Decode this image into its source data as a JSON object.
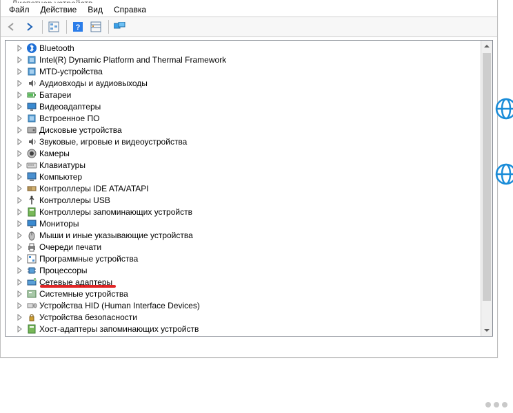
{
  "window": {
    "title": "Диспетчер устройств"
  },
  "menu": {
    "file": "Файл",
    "action": "Действие",
    "view": "Вид",
    "help": "Справка"
  },
  "toolbar": {
    "back": "arrow-left",
    "forward": "arrow-right",
    "show_tree": "show-tree",
    "help": "help",
    "show_hidden": "show-hidden",
    "monitors": "monitors"
  },
  "tree": {
    "items": [
      {
        "label": "Bluetooth",
        "icon": "bluetooth"
      },
      {
        "label": "Intel(R) Dynamic Platform and Thermal Framework",
        "icon": "chip"
      },
      {
        "label": "MTD-устройства",
        "icon": "chip"
      },
      {
        "label": "Аудиовходы и аудиовыходы",
        "icon": "audio"
      },
      {
        "label": "Батареи",
        "icon": "battery"
      },
      {
        "label": "Видеоадаптеры",
        "icon": "display"
      },
      {
        "label": "Встроенное ПО",
        "icon": "chip"
      },
      {
        "label": "Дисковые устройства",
        "icon": "disk"
      },
      {
        "label": "Звуковые, игровые и видеоустройства",
        "icon": "audio"
      },
      {
        "label": "Камеры",
        "icon": "camera"
      },
      {
        "label": "Клавиатуры",
        "icon": "keyboard"
      },
      {
        "label": "Компьютер",
        "icon": "computer"
      },
      {
        "label": "Контроллеры IDE ATA/ATAPI",
        "icon": "ide"
      },
      {
        "label": "Контроллеры USB",
        "icon": "usb"
      },
      {
        "label": "Контроллеры запоминающих устройств",
        "icon": "storage"
      },
      {
        "label": "Мониторы",
        "icon": "monitor"
      },
      {
        "label": "Мыши и иные указывающие устройства",
        "icon": "mouse"
      },
      {
        "label": "Очереди печати",
        "icon": "printer"
      },
      {
        "label": "Программные устройства",
        "icon": "software"
      },
      {
        "label": "Процессоры",
        "icon": "cpu"
      },
      {
        "label": "Сетевые адаптеры",
        "icon": "network",
        "underline": true
      },
      {
        "label": "Системные устройства",
        "icon": "system"
      },
      {
        "label": "Устройства HID (Human Interface Devices)",
        "icon": "hid"
      },
      {
        "label": "Устройства безопасности",
        "icon": "security"
      },
      {
        "label": "Хост-адаптеры запоминающих устройств",
        "icon": "storage"
      }
    ]
  }
}
